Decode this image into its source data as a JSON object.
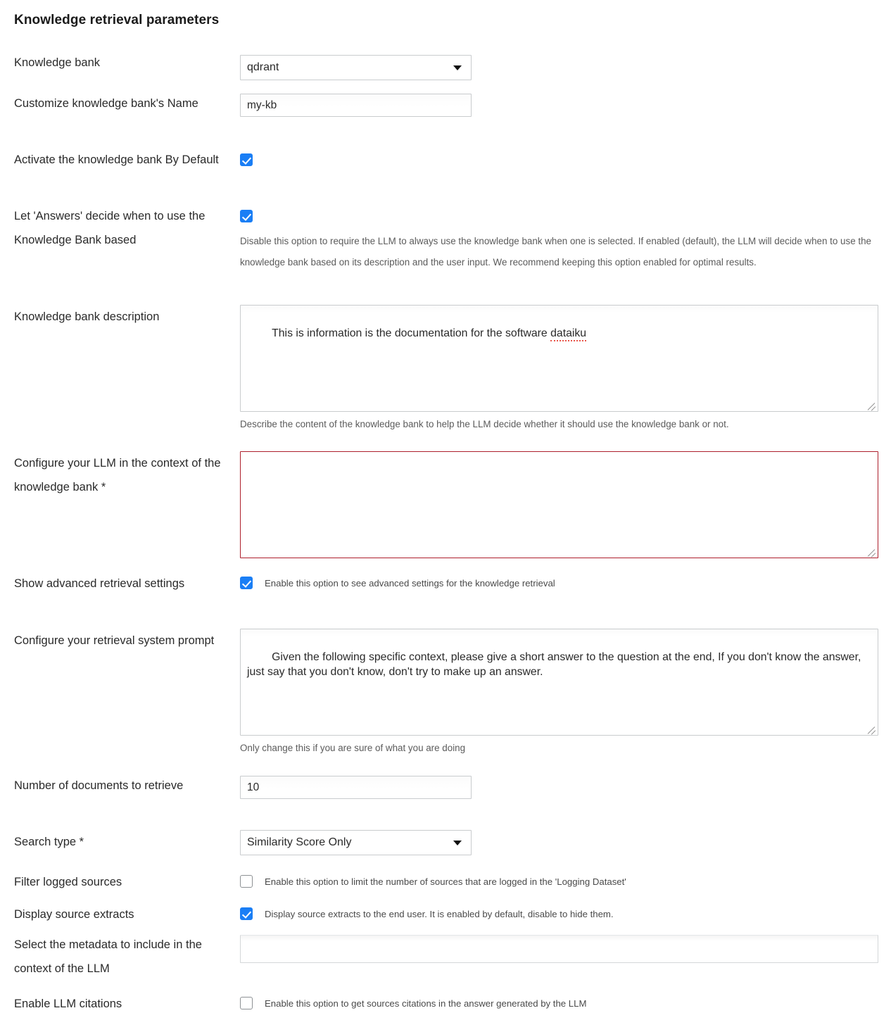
{
  "page": {
    "title": "Knowledge retrieval parameters"
  },
  "fields": {
    "knowledge_bank": {
      "label": "Knowledge bank",
      "value": "qdrant",
      "type": "select"
    },
    "customize_name": {
      "label": "Customize knowledge bank's Name",
      "value": "my-kb",
      "type": "text"
    },
    "activate_by_default": {
      "label": "Activate the knowledge bank By Default",
      "checked": true,
      "type": "checkbox"
    },
    "let_answers_decide": {
      "label": "Let 'Answers' decide when to use the Knowledge Bank based",
      "checked": true,
      "type": "checkbox",
      "description": "Disable this option to require the LLM to always use the knowledge bank when one is selected. If enabled (default), the LLM will decide when to use the knowledge bank based on its description and the user input. We recommend keeping this option enabled for optimal results."
    },
    "kb_description": {
      "label": "Knowledge bank description",
      "value_prefix": "This is information is the documentation for the software ",
      "value_misspelled": "dataiku",
      "helper": "Describe the content of the knowledge bank to help the LLM decide whether it should use the knowledge bank or not.",
      "type": "textarea"
    },
    "llm_context": {
      "label": "Configure your LLM in the context of the knowledge bank *",
      "value": "",
      "type": "textarea",
      "error": true
    },
    "show_advanced": {
      "label": "Show advanced retrieval settings",
      "checked": true,
      "type": "checkbox",
      "caption": "Enable this option to see advanced settings for the knowledge retrieval"
    },
    "retrieval_system_prompt": {
      "label": "Configure your retrieval system prompt",
      "value": "Given the following specific context, please give a short answer to the question at the end, If you don't know the answer, just say that you don't know, don't try to make up an answer.",
      "helper": "Only change this if you are sure of what you are doing",
      "type": "textarea"
    },
    "num_documents": {
      "label": "Number of documents to retrieve",
      "value": "10",
      "type": "text"
    },
    "search_type": {
      "label": "Search type *",
      "value": "Similarity Score Only",
      "type": "select"
    },
    "filter_logged_sources": {
      "label": "Filter logged sources",
      "checked": false,
      "type": "checkbox",
      "caption": "Enable this option to limit the number of sources that are logged in the 'Logging Dataset'"
    },
    "display_source_extracts": {
      "label": "Display source extracts",
      "checked": true,
      "type": "checkbox",
      "caption": "Display source extracts to the end user. It is enabled by default, disable to hide them."
    },
    "metadata_select": {
      "label": "Select the metadata to include in the context of the LLM",
      "value": "",
      "type": "multiselect"
    },
    "enable_citations": {
      "label": "Enable LLM citations",
      "checked": false,
      "type": "checkbox",
      "caption": "Enable this option to get sources citations in the answer generated by the LLM"
    }
  },
  "colors": {
    "accent": "#1a7ef5",
    "error_border": "#ad1f2c",
    "spellcheck_underline": "#e8554a",
    "text": "#2a2a2a",
    "helper_text": "#5b5b5b"
  },
  "icons": {
    "dropdown_caret": "chevron-down-icon",
    "resize_handle": "resize-handle-icon",
    "checkmark": "check-icon"
  }
}
